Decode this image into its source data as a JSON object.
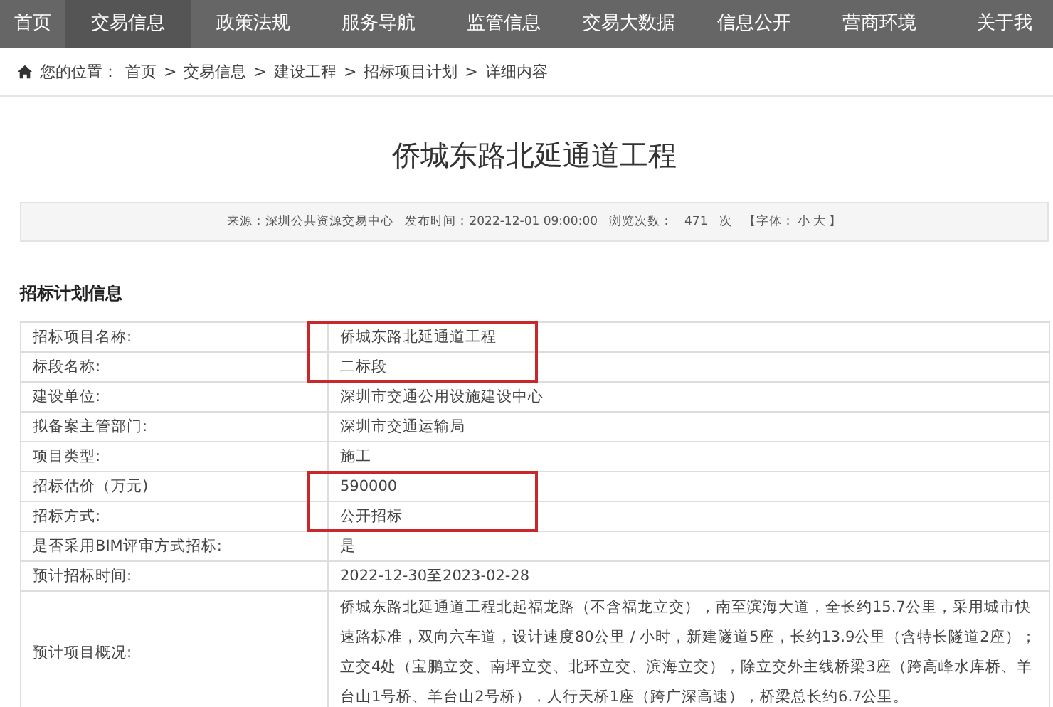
{
  "nav": [
    {
      "label": "首页",
      "selected": false
    },
    {
      "label": "交易信息",
      "selected": true
    },
    {
      "label": "政策法规",
      "selected": false
    },
    {
      "label": "服务导航",
      "selected": false
    },
    {
      "label": "监管信息",
      "selected": false
    },
    {
      "label": "交易大数据",
      "selected": false
    },
    {
      "label": "信息公开",
      "selected": false
    },
    {
      "label": "营商环境",
      "selected": false
    },
    {
      "label": "关于我",
      "selected": false
    }
  ],
  "breadcrumb": {
    "prefix": "您的位置：",
    "separator": ">",
    "items": [
      "首页",
      "交易信息",
      "建设工程",
      "招标项目计划",
      "详细内容"
    ]
  },
  "title": "侨城东路北延通道工程",
  "meta": {
    "source": "来源：深圳公共资源交易中心",
    "published": "发布时间：2022-12-01 09:00:00",
    "views_label": "浏览次数：",
    "views": "471",
    "views_unit": "次",
    "font_open": "【字体：",
    "font_small": "小",
    "font_large": "大",
    "font_close": "】"
  },
  "section_title": "招标计划信息",
  "rows": [
    {
      "label": "招标项目名称:",
      "value": "侨城东路北延通道工程",
      "highlighted": true
    },
    {
      "label": "标段名称:",
      "value": "二标段",
      "highlighted": true
    },
    {
      "label": "建设单位:",
      "value": "深圳市交通公用设施建设中心",
      "highlighted": false
    },
    {
      "label": "拟备案主管部门:",
      "value": "深圳市交通运输局",
      "highlighted": false
    },
    {
      "label": "项目类型:",
      "value": "施工",
      "highlighted": false
    },
    {
      "label": "招标估价（万元)",
      "value": "590000",
      "highlighted": true
    },
    {
      "label": "招标方式:",
      "value": "公开招标",
      "highlighted": true
    },
    {
      "label": "是否采用BIM评审方式招标:",
      "value": "是",
      "highlighted": false
    },
    {
      "label": "预计招标时间:",
      "value": "2022-12-30至2023-02-28",
      "highlighted": false
    },
    {
      "label": "预计项目概况:",
      "value": "侨城东路北延通道工程北起福龙路（不含福龙立交），南至滨海大道，全长约15.7公里，采用城市快速路标准，双向六车道，设计速度80公里 / 小时，新建隧道5座，长约13.9公里（含特长隧道2座）；立交4处（宝鹏立交、南坪立交、北环立交、滨海立交），除立交外主线桥梁3座（跨高峰水库桥、羊台山1号桥、羊台山2号桥），人行天桥1座（跨广深高速），桥梁总长约6.7公里。",
      "highlighted": false
    }
  ]
}
